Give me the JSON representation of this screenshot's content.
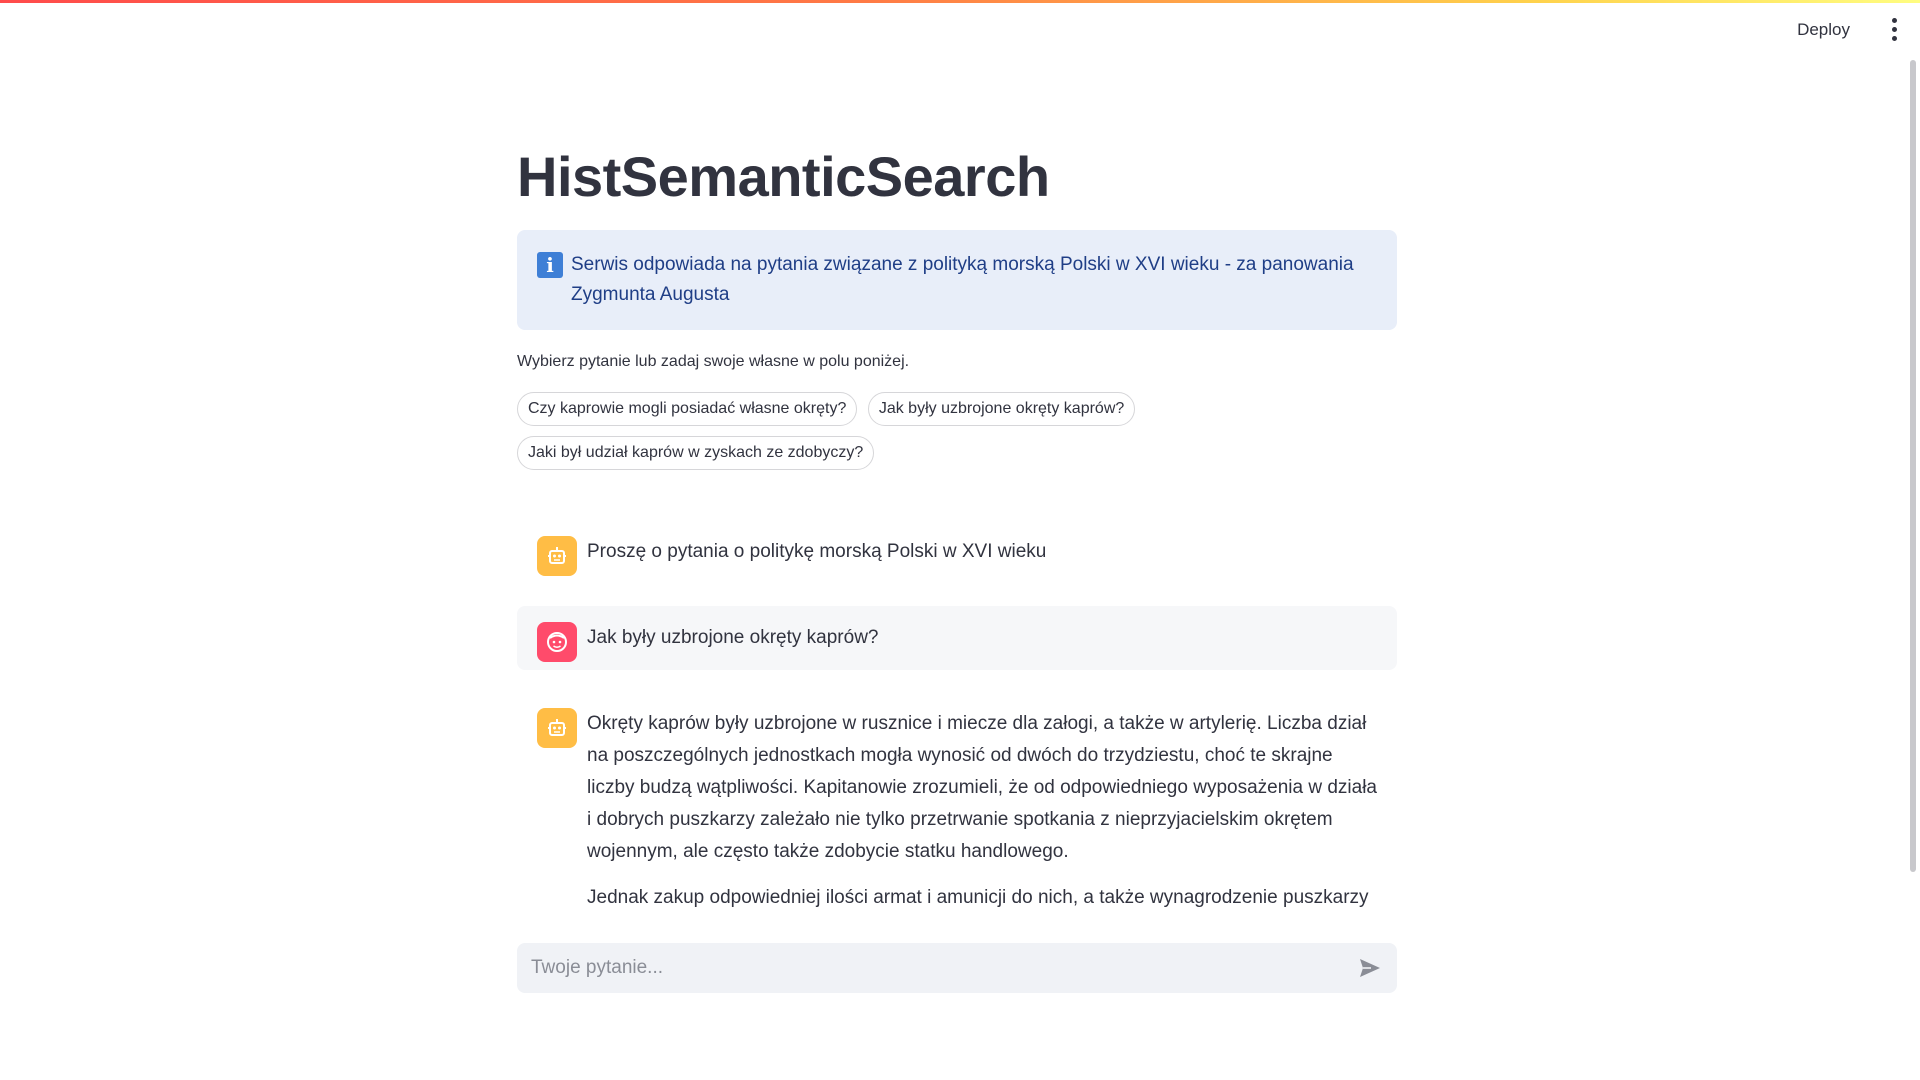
{
  "header": {
    "deploy_label": "Deploy",
    "menu_icon": "kebab-menu-icon"
  },
  "main": {
    "title": "HistSemanticSearch",
    "info": {
      "icon": "info-icon",
      "text": "Serwis odpowiada na pytania związane z polityką morską Polski w XVI wieku - za panowania Zygmunta Augusta"
    },
    "prompt_hint": "Wybierz pytanie lub zadaj swoje własne w polu poniżej.",
    "suggestions": [
      "Czy kaprowie mogli posiadać własne okręty?",
      "Jak były uzbrojone okręty kaprów?",
      "Jaki był udział kaprów w zyskach ze zdobyczy?"
    ]
  },
  "chat": {
    "messages": [
      {
        "role": "assistant",
        "avatar_icon": "robot-icon",
        "text": "Proszę o pytania o politykę morską Polski w XVI wieku"
      },
      {
        "role": "user",
        "avatar_icon": "face-icon",
        "text": "Jak były uzbrojone okręty kaprów?"
      },
      {
        "role": "assistant",
        "avatar_icon": "robot-icon",
        "paragraphs": [
          "Okręty kaprów były uzbrojone w rusznice i miecze dla załogi, a także w artylerię. Liczba dział na poszczególnych jednostkach mogła wynosić od dwóch do trzydziestu, choć te skrajne liczby budzą wątpliwości. Kapitanowie zrozumieli, że od odpowiedniego wyposażenia w działa i dobrych puszkarzy zależało nie tylko przetrwanie spotkania z nieprzyjacielskim okrętem wojennym, ale często także zdobycie statku handlowego.",
          "Jednak zakup odpowiedniej ilości armat i amunicji do nich, a także wynagrodzenie puszkarzy"
        ]
      }
    ]
  },
  "input": {
    "placeholder": "Twoje pytanie...",
    "value": "",
    "send_icon": "send-icon"
  },
  "colors": {
    "bot_avatar": "#ffbd45",
    "user_avatar": "#ff4b6b",
    "info_background": "#e8eef9",
    "info_text": "#1f3e86"
  }
}
